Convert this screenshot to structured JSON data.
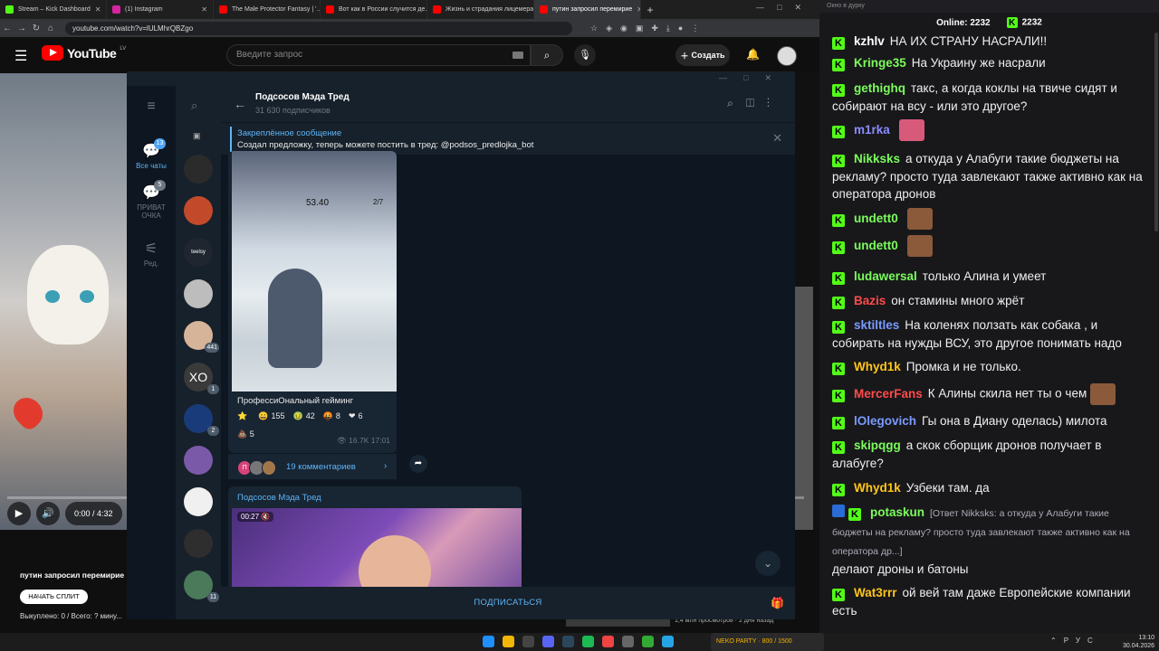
{
  "browser": {
    "tabs": [
      {
        "label": "Stream – Kick Dashboard",
        "color": "#53fc18",
        "active": false
      },
      {
        "label": "(1) Instagram",
        "color": "#d6249f",
        "active": false
      },
      {
        "label": "The Male Protector Fantasy | '...",
        "color": "#ff0000",
        "active": false
      },
      {
        "label": "Вот как в России случится де...",
        "color": "#ff0000",
        "active": false
      },
      {
        "label": "Жизнь и страдания лицемера",
        "color": "#ff0000",
        "active": false
      },
      {
        "label": "путин запросил перемирие",
        "color": "#ff0000",
        "active": true
      }
    ],
    "url": "youtube.com/watch?v=lULMhrQBZgo"
  },
  "youtube": {
    "logo": "YouTube",
    "country": "LV",
    "search_placeholder": "Введите запрос",
    "create_label": "Создать",
    "time": "0:00 / 4:32",
    "progress": 0.0,
    "video_title": "путин запросил перемирие",
    "split_button": "НАЧАТЬ СПЛИТ",
    "bought": "Выкуплено: 0 / Всего: ? мину...",
    "views": "1,4 млн просмотров · 2 дня назад"
  },
  "telegram": {
    "folders": [
      {
        "label": "Все чаты",
        "badge": "13",
        "icon": "chat-bubbles-icon",
        "active": true
      },
      {
        "label": "ПРИВАТ ОЧКА",
        "badge": "5",
        "icon": "chat-bubbles-icon",
        "active": false
      },
      {
        "label": "Ред.",
        "badge": "",
        "icon": "sliders-icon",
        "active": false
      }
    ],
    "chat_list": [
      {
        "color": "#2b2b2b",
        "badge": ""
      },
      {
        "color": "#c24a2a",
        "badge": ""
      },
      {
        "color": "#1f2630",
        "badge": "",
        "text": "teelsy"
      },
      {
        "color": "#bdbdbd",
        "badge": ""
      },
      {
        "color": "#d6b49a",
        "badge": "441"
      },
      {
        "color": "#3a3a3a",
        "badge": "1",
        "text": "XO"
      },
      {
        "color": "#1a3b7a",
        "badge": "2"
      },
      {
        "color": "#7a5aa8",
        "badge": ""
      },
      {
        "color": "#f0f0f0",
        "badge": ""
      },
      {
        "color": "#2e2e2e",
        "badge": ""
      },
      {
        "color": "#4a7a5a",
        "badge": "11"
      }
    ],
    "channel_name": "Подсосов Мэда Тред",
    "subscribers": "31 630 подписчиков",
    "pinned_title": "Закреплённое сообщение",
    "pinned_text": "Создал предложку, теперь можете  постить в тред: @podsos_predlojka_bot",
    "post1": {
      "hud_number": "53.40",
      "hud_counter": "2/7",
      "caption": "ПрофессиОнальный гейминг",
      "reactions": [
        {
          "emoji": "⭐",
          "count": ""
        },
        {
          "emoji": "😄",
          "count": "155"
        },
        {
          "emoji": "🤢",
          "count": "42"
        },
        {
          "emoji": "🤬",
          "count": "8"
        },
        {
          "emoji": "❤",
          "count": "6"
        }
      ],
      "reaction_extra": {
        "emoji": "💩",
        "count": "5"
      },
      "views": "16.7K",
      "time": "17:01",
      "comments": "19 комментариев",
      "comment_avatar_letter": "П"
    },
    "post2": {
      "channel": "Подсосов Мэда Тред",
      "duration": "00:27"
    },
    "subscribe_label": "ПОДПИСАТЬСЯ"
  },
  "chat": {
    "title": "Окно в дурку",
    "online_label": "Online: 2232",
    "viewer_count": "2232",
    "messages": [
      {
        "user": "kzhlv",
        "color": "#ffffff",
        "text": "НА ИХ СТРАНУ НАСРАЛИ!!",
        "emote": ""
      },
      {
        "user": "Kringe35",
        "color": "#7cfc5c",
        "text": "На Украину же насрали",
        "emote": ""
      },
      {
        "user": "gethighq",
        "color": "#7cfc5c",
        "text": "такс, а когда коклы на твиче сидят и собирают на всу - или это другое?",
        "emote": ""
      },
      {
        "user": "m1rka",
        "color": "#8a8cff",
        "text": "",
        "emote": "pink"
      },
      {
        "user": "Nikksks",
        "color": "#7cfc5c",
        "text": "а откуда у Алабуги такие бюджеты на рекламу? просто туда завлекают также активно как на оператора дронов",
        "emote": ""
      },
      {
        "user": "undett0",
        "color": "#7cfc5c",
        "text": "",
        "emote": "brown"
      },
      {
        "user": "undett0",
        "color": "#7cfc5c",
        "text": "",
        "emote": "brown"
      },
      {
        "user": "ludawersal",
        "color": "#7cfc5c",
        "text": "только Алина и умеет",
        "emote": ""
      },
      {
        "user": "Bazis",
        "color": "#ff4b4b",
        "text": "он стамины много жрёт",
        "emote": ""
      },
      {
        "user": "sktiltles",
        "color": "#7a9bff",
        "text": "На коленях ползать как собака , и собирать на нужды ВСУ, это другое понимать надо",
        "emote": ""
      },
      {
        "user": "Whyd1k",
        "color": "#ffc61a",
        "text": "Промка и не только.",
        "emote": ""
      },
      {
        "user": "MercerFans",
        "color": "#ff4b4b",
        "text": "К Алины скила нет ты о чем",
        "emote": "brown"
      },
      {
        "user": "lOlegovich",
        "color": "#7a9bff",
        "text": "Гы она в Диану оделась) милота",
        "emote": ""
      },
      {
        "user": "skipqgg",
        "color": "#7cfc5c",
        "text": "а скок сборщик дронов получает в алабуге?",
        "emote": ""
      },
      {
        "user": "Whyd1k",
        "color": "#ffc61a",
        "text": "Узбеки там. да",
        "emote": ""
      },
      {
        "user": "potaskun",
        "color": "#7cfc5c",
        "reply": "[Ответ Nikksks: а откуда у Алабуги такие бюджеты на рекламу? просто туда завлекают также активно как на оператора др...]",
        "text": "делают дроны и батоны",
        "emote": ""
      },
      {
        "user": "Wat3rrr",
        "color": "#ffc61a",
        "text": "ой вей там даже Европейские компании есть",
        "emote": ""
      }
    ]
  },
  "taskbar": {
    "badge": "NEKO PARTY · 800 / 1500",
    "lang": "РУС",
    "time": "13:10",
    "date": "30.04.2026"
  }
}
